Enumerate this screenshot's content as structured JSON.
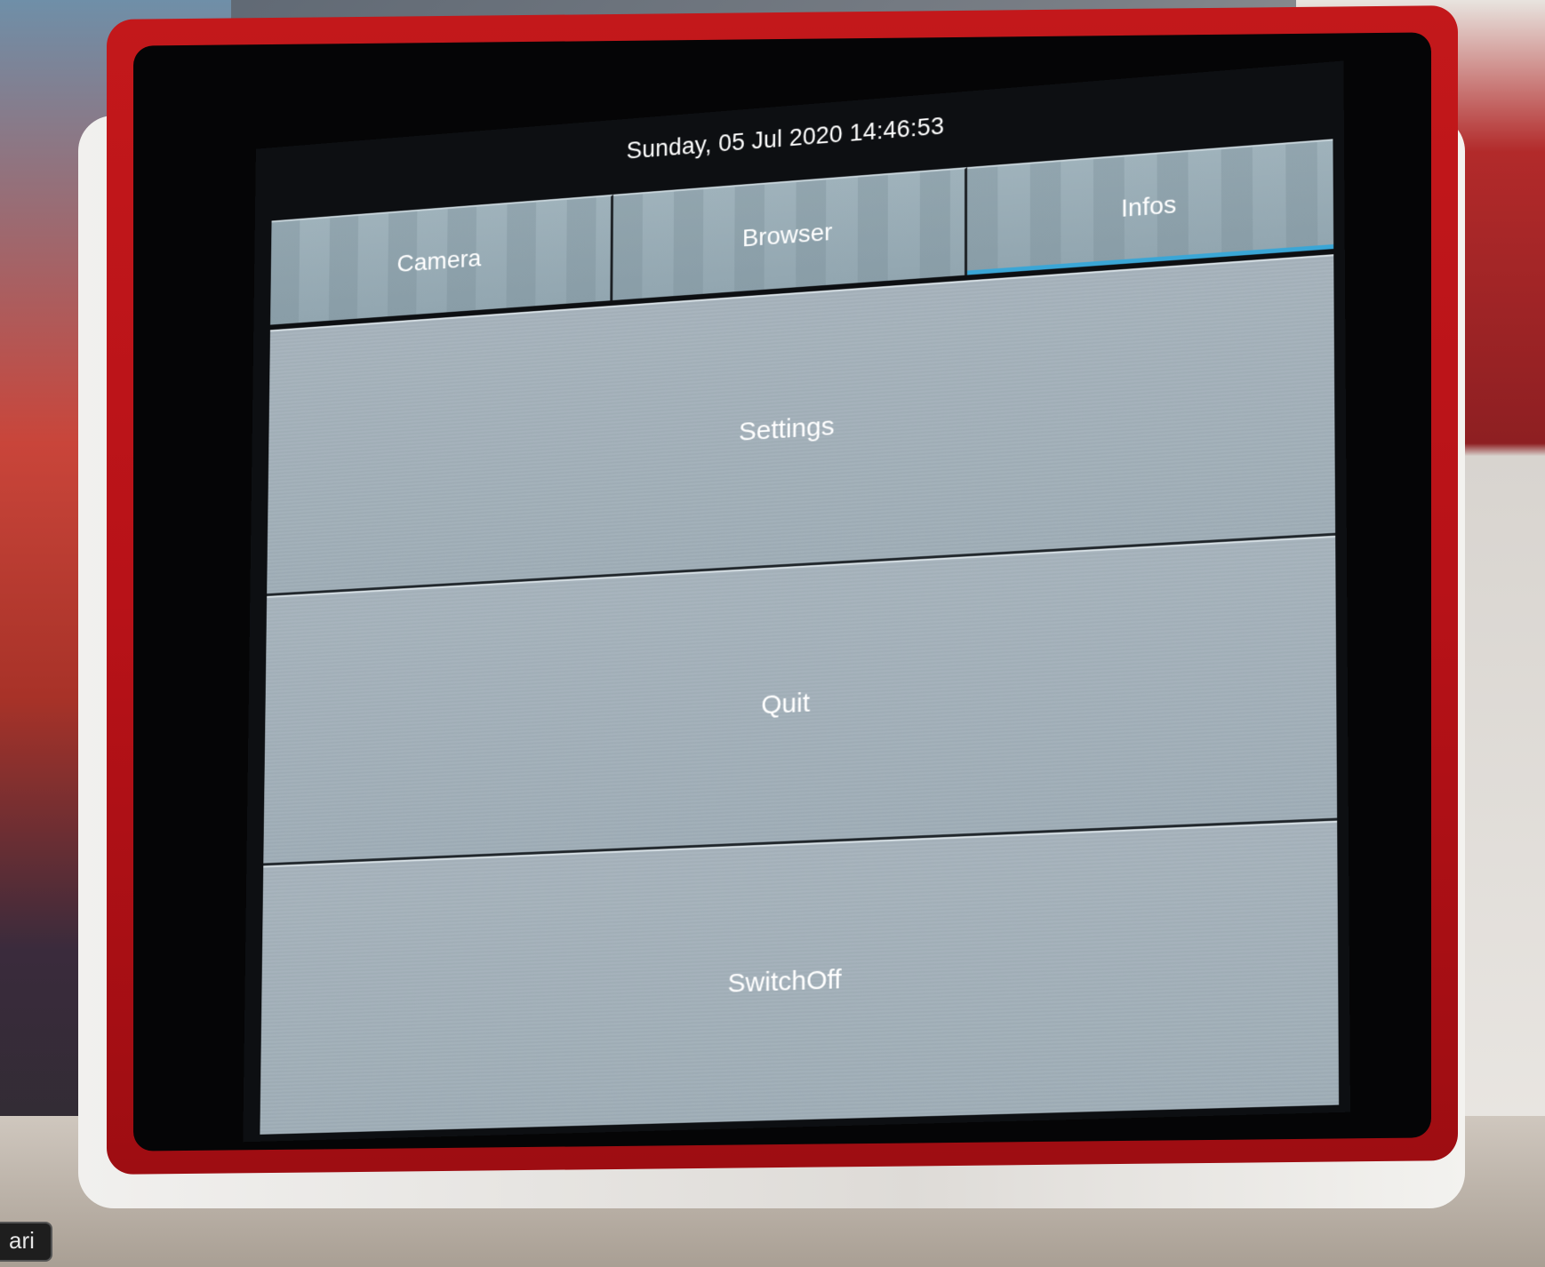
{
  "status": {
    "datetime": "Sunday, 05 Jul 2020 14:46:53"
  },
  "tabs": [
    {
      "label": "Camera",
      "active": false
    },
    {
      "label": "Browser",
      "active": false
    },
    {
      "label": "Infos",
      "active": true
    }
  ],
  "menu": {
    "items": [
      {
        "label": "Settings"
      },
      {
        "label": "Quit"
      },
      {
        "label": "SwitchOff"
      }
    ]
  },
  "overlay": {
    "corner_text": "ari"
  },
  "colors": {
    "frame": "#b81218",
    "bezel": "#050506",
    "button_bg": "#a6b3bc",
    "active_tab_underline": "#3aa6d6"
  }
}
